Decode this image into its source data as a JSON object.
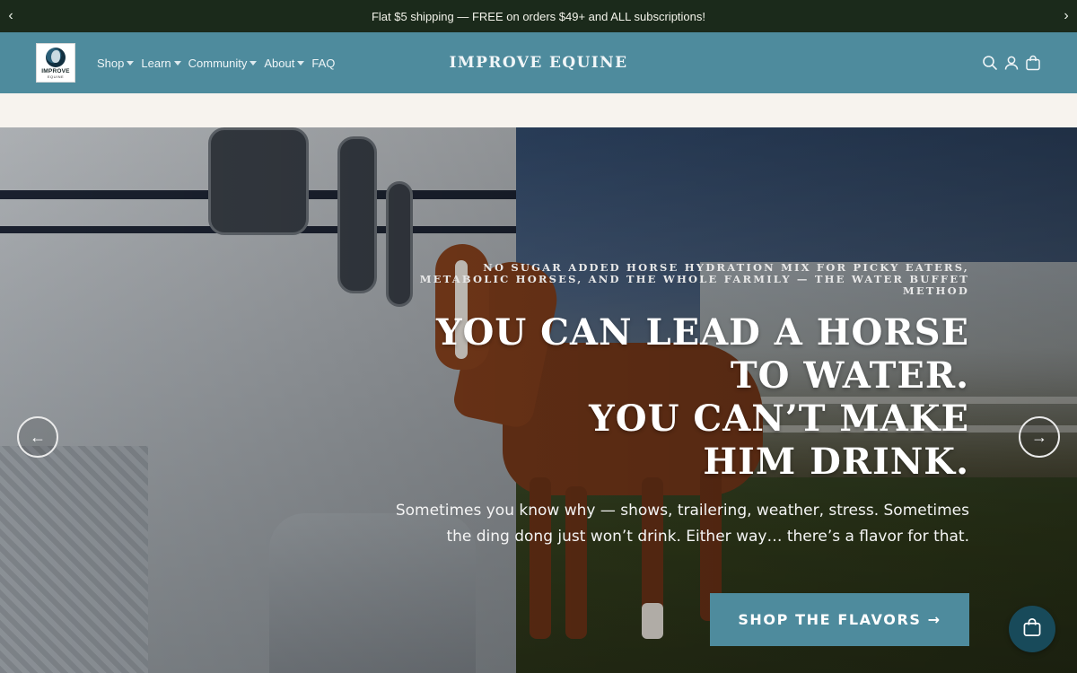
{
  "announcement": {
    "text": "Flat $5 shipping — FREE on orders $49+ and ALL subscriptions!",
    "prev_arrow": "‹",
    "next_arrow": "›"
  },
  "header": {
    "logo": {
      "line1": "IMPROVE",
      "line2": "EQUINE"
    },
    "brand_title": "IMPROVE EQUINE",
    "nav": [
      {
        "label": "Shop",
        "has_dropdown": true
      },
      {
        "label": "Learn",
        "has_dropdown": true
      },
      {
        "label": "Community",
        "has_dropdown": true
      },
      {
        "label": "About",
        "has_dropdown": true
      },
      {
        "label": "FAQ",
        "has_dropdown": false
      }
    ],
    "icons": [
      "search-icon",
      "account-icon",
      "cart-icon"
    ]
  },
  "hero": {
    "eyebrow": "NO SUGAR ADDED HORSE HYDRATION MIX FOR PICKY EATERS, METABOLIC HORSES, AND THE WHOLE FARMILY — THE WATER BUFFET METHOD",
    "headline_lines": [
      "YOU CAN LEAD A HORSE",
      "TO WATER.",
      "YOU CAN’T MAKE",
      "HIM DRINK."
    ],
    "subtext": "Sometimes you know why — shows, trailering, weather, stress. Sometimes the ding dong just won’t drink. Either way… there’s a flavor for that.",
    "cta_label": "SHOP THE FLAVORS →",
    "prev_label": "←",
    "next_label": "→"
  },
  "colors": {
    "announcement_bg": "#1b2a1b",
    "header_bg": "#4e8b9d",
    "cta_bg": "#4e8b9d",
    "floating_cart_bg": "#184a5a",
    "strip_bg": "#f7f3ee"
  }
}
